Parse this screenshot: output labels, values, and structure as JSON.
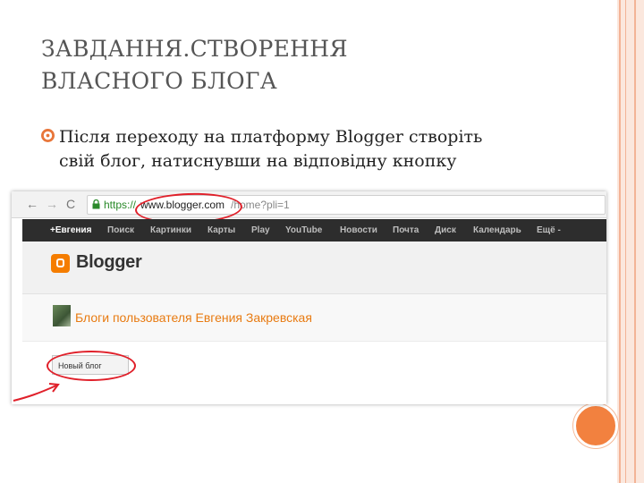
{
  "slide": {
    "title_line1": "ЗАВДАННЯ.СТВОРЕННЯ",
    "title_line2": "ВЛАСНОГО БЛОГА",
    "bullet_line1": "Після переходу на платформу Blogger створіть",
    "bullet_line2": "свій блог, натиснувши на відповідну кнопку"
  },
  "browser": {
    "back": "←",
    "forward": "→",
    "reload": "C",
    "url_scheme": "https://",
    "url_host": "www.blogger.com",
    "url_path": "/home?pli=1"
  },
  "google_bar": {
    "items": [
      "+Евгения",
      "Поиск",
      "Картинки",
      "Карты",
      "Play",
      "YouTube",
      "Новости",
      "Почта",
      "Диск",
      "Календарь",
      "Ещё -"
    ]
  },
  "blogger": {
    "logo_text": "Blogger",
    "user_blogs_title": "Блоги пользователя Евгения Закревская",
    "new_blog_button": "Новый блог"
  },
  "colors": {
    "accent_orange": "#f2813f",
    "blogger_orange": "#f57d00",
    "annotation_red": "#e0202a",
    "gbar_bg": "#2d2d2d"
  },
  "icons": [
    "bullet-icon",
    "back-arrow-icon",
    "forward-arrow-icon",
    "reload-icon",
    "lock-icon",
    "blogger-logo-icon",
    "avatar"
  ]
}
